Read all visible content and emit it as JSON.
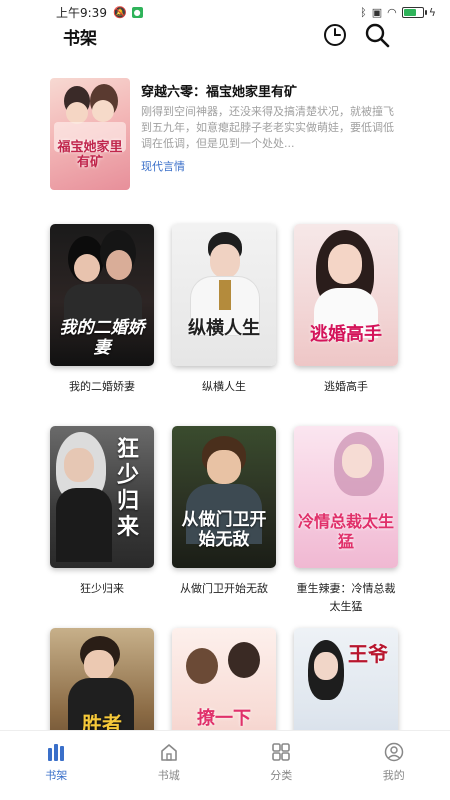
{
  "status": {
    "time": "上午9:39"
  },
  "header": {
    "title": "书架"
  },
  "featured": {
    "title": "穿越六零：福宝她家里有矿",
    "description": "刚得到空间神器，还没来得及搞清楚状况，就被撞飞到五九年，如意瘪起脖子老老实实做萌娃，要低调低调在低调，但是见到一个处处...",
    "tag": "现代言情",
    "cover_text": "福宝她家里有矿"
  },
  "books": [
    {
      "title": "我的二婚娇妻",
      "cover_text": "我的二婚娇妻"
    },
    {
      "title": "纵横人生",
      "cover_text": "纵横人生"
    },
    {
      "title": "逃婚高手",
      "cover_text": "逃婚高手"
    },
    {
      "title": "狂少归来",
      "cover_text": "狂少归来"
    },
    {
      "title": "从做门卫开始无敌",
      "cover_text": "从做门卫开始无敌"
    },
    {
      "title": "重生辣妻：冷情总裁太生猛",
      "cover_text": "冷情总裁太生猛"
    },
    {
      "title": "",
      "cover_text": "胜者"
    },
    {
      "title": "",
      "cover_text": "撩一下"
    },
    {
      "title": "",
      "cover_text": "王爷"
    }
  ],
  "nav": [
    {
      "label": "书架",
      "icon": "bookshelf-icon"
    },
    {
      "label": "书城",
      "icon": "home-icon"
    },
    {
      "label": "分类",
      "icon": "grid-icon"
    },
    {
      "label": "我的",
      "icon": "user-icon"
    }
  ],
  "colors": {
    "accent": "#3a6fc9",
    "tag": "#3a6fc9",
    "muted": "#a0a0a0"
  }
}
